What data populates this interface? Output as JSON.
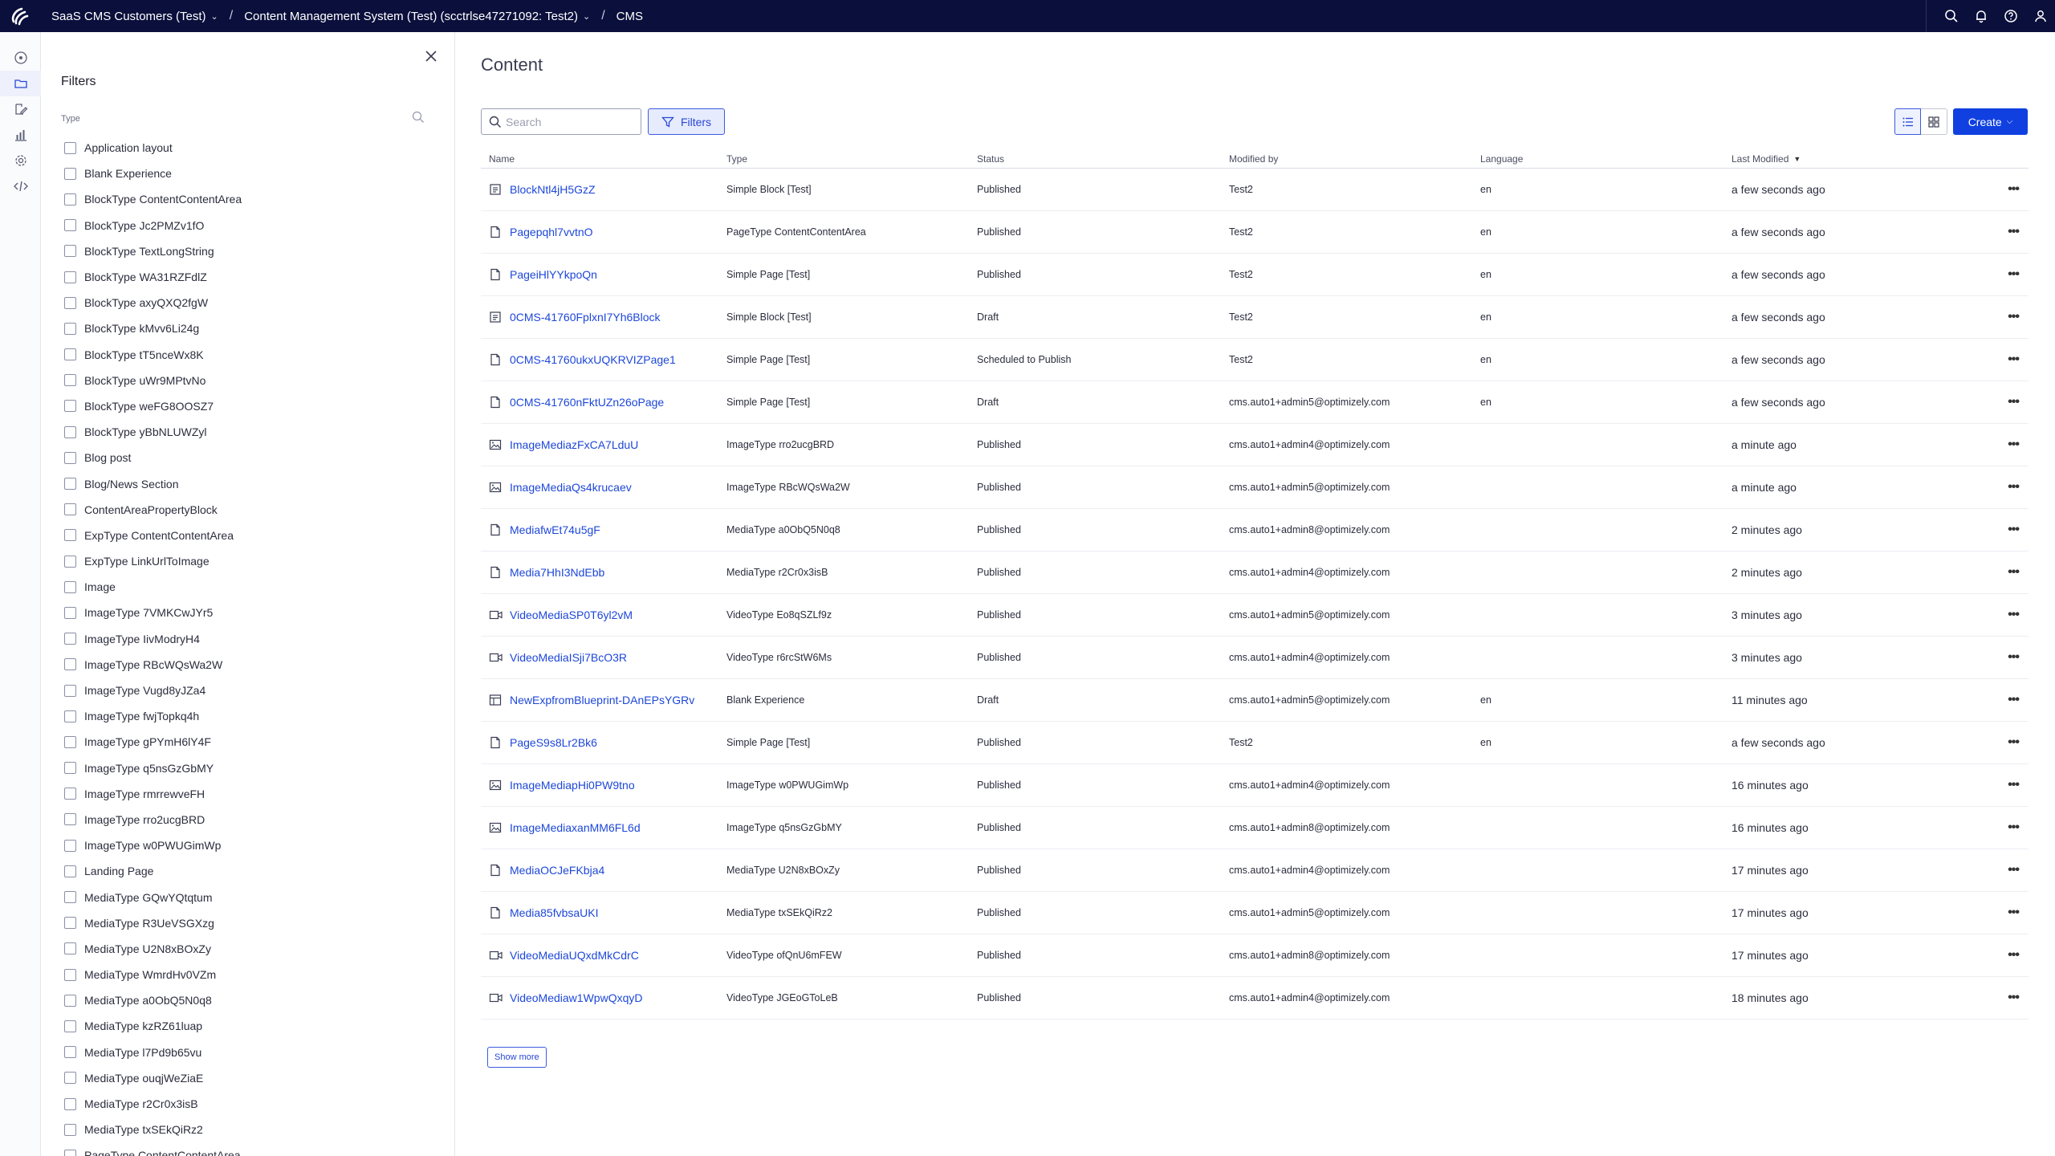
{
  "topbar": {
    "breadcrumbs": [
      {
        "label": "SaaS CMS Customers (Test)",
        "has_dropdown": true
      },
      {
        "label": "Content Management System (Test) (scctrlse47271092: Test2)",
        "has_dropdown": true
      },
      {
        "label": "CMS",
        "has_dropdown": false
      }
    ],
    "icons": [
      "search-icon",
      "bell-icon",
      "help-icon",
      "user-icon"
    ],
    "background": "#0b0f3c"
  },
  "rail": {
    "icons": [
      "dashboard-icon",
      "content-icon",
      "edit-icon",
      "analytics-icon",
      "settings-icon",
      "code-icon"
    ]
  },
  "filters": {
    "title": "Filters",
    "type_label": "Type",
    "types": [
      "Application layout",
      "Blank Experience",
      "BlockType ContentContentArea",
      "BlockType Jc2PMZv1fO",
      "BlockType TextLongString",
      "BlockType WA31RZFdlZ",
      "BlockType axyQXQ2fgW",
      "BlockType kMvv6Li24g",
      "BlockType tT5nceWx8K",
      "BlockType uWr9MPtvNo",
      "BlockType weFG8OOSZ7",
      "BlockType yBbNLUWZyl",
      "Blog post",
      "Blog/News Section",
      "ContentAreaPropertyBlock",
      "ExpType ContentContentArea",
      "ExpType LinkUrlToImage",
      "Image",
      "ImageType 7VMKCwJYr5",
      "ImageType IivModryH4",
      "ImageType RBcWQsWa2W",
      "ImageType Vugd8yJZa4",
      "ImageType fwjTopkq4h",
      "ImageType gPYmH6lY4F",
      "ImageType q5nsGzGbMY",
      "ImageType rmrrewveFH",
      "ImageType rro2ucgBRD",
      "ImageType w0PWUGimWp",
      "Landing Page",
      "MediaType GQwYQtqtum",
      "MediaType R3UeVSGXzg",
      "MediaType U2N8xBOxZy",
      "MediaType WmrdHv0VZm",
      "MediaType a0ObQ5N0q8",
      "MediaType kzRZ61luap",
      "MediaType l7Pd9b65vu",
      "MediaType ouqjWeZiaE",
      "MediaType r2Cr0x3isB",
      "MediaType txSEkQiRz2",
      "PageType ContentContentArea"
    ]
  },
  "main": {
    "title": "Content",
    "search_placeholder": "Search",
    "filters_button": "Filters",
    "create_button": "Create",
    "accent": "#1040e0",
    "columns": {
      "name": "Name",
      "type": "Type",
      "status": "Status",
      "modified_by": "Modified by",
      "language": "Language",
      "last_modified": "Last Modified"
    },
    "rows": [
      {
        "icon": "block-icon",
        "name": "BlockNtl4jH5GzZ",
        "type": "Simple Block [Test]",
        "status": "Published",
        "modified_by": "Test2",
        "language": "en",
        "last_modified": "a few seconds ago"
      },
      {
        "icon": "page-icon",
        "name": "Pagepqhl7vvtnO",
        "type": "PageType ContentContentArea",
        "status": "Published",
        "modified_by": "Test2",
        "language": "en",
        "last_modified": "a few seconds ago"
      },
      {
        "icon": "page-icon",
        "name": "PageiHlYYkpoQn",
        "type": "Simple Page [Test]",
        "status": "Published",
        "modified_by": "Test2",
        "language": "en",
        "last_modified": "a few seconds ago"
      },
      {
        "icon": "block-icon",
        "name": "0CMS-41760FplxnI7Yh6Block",
        "type": "Simple Block [Test]",
        "status": "Draft",
        "modified_by": "Test2",
        "language": "en",
        "last_modified": "a few seconds ago"
      },
      {
        "icon": "page-icon",
        "name": "0CMS-41760ukxUQKRVIZPage1",
        "type": "Simple Page [Test]",
        "status": "Scheduled to Publish",
        "modified_by": "Test2",
        "language": "en",
        "last_modified": "a few seconds ago"
      },
      {
        "icon": "page-icon",
        "name": "0CMS-41760nFktUZn26oPage",
        "type": "Simple Page [Test]",
        "status": "Draft",
        "modified_by": "cms.auto1+admin5@optimizely.com",
        "language": "en",
        "last_modified": "a few seconds ago"
      },
      {
        "icon": "image-icon",
        "name": "ImageMediazFxCA7LduU",
        "type": "ImageType rro2ucgBRD",
        "status": "Published",
        "modified_by": "cms.auto1+admin4@optimizely.com",
        "language": "",
        "last_modified": "a minute ago"
      },
      {
        "icon": "image-icon",
        "name": "ImageMediaQs4krucaev",
        "type": "ImageType RBcWQsWa2W",
        "status": "Published",
        "modified_by": "cms.auto1+admin5@optimizely.com",
        "language": "",
        "last_modified": "a minute ago"
      },
      {
        "icon": "page-icon",
        "name": "MediafwEt74u5gF",
        "type": "MediaType a0ObQ5N0q8",
        "status": "Published",
        "modified_by": "cms.auto1+admin8@optimizely.com",
        "language": "",
        "last_modified": "2 minutes ago"
      },
      {
        "icon": "page-icon",
        "name": "Media7HhI3NdEbb",
        "type": "MediaType r2Cr0x3isB",
        "status": "Published",
        "modified_by": "cms.auto1+admin4@optimizely.com",
        "language": "",
        "last_modified": "2 minutes ago"
      },
      {
        "icon": "video-icon",
        "name": "VideoMediaSP0T6yl2vM",
        "type": "VideoType Eo8qSZLf9z",
        "status": "Published",
        "modified_by": "cms.auto1+admin5@optimizely.com",
        "language": "",
        "last_modified": "3 minutes ago"
      },
      {
        "icon": "video-icon",
        "name": "VideoMediaISji7BcO3R",
        "type": "VideoType r6rcStW6Ms",
        "status": "Published",
        "modified_by": "cms.auto1+admin4@optimizely.com",
        "language": "",
        "last_modified": "3 minutes ago"
      },
      {
        "icon": "experience-icon",
        "name": "NewExpfromBlueprint-DAnEPsYGRv",
        "type": "Blank Experience",
        "status": "Draft",
        "modified_by": "cms.auto1+admin5@optimizely.com",
        "language": "en",
        "last_modified": "11 minutes ago"
      },
      {
        "icon": "page-icon",
        "name": "PageS9s8Lr2Bk6",
        "type": "Simple Page [Test]",
        "status": "Published",
        "modified_by": "Test2",
        "language": "en",
        "last_modified": "a few seconds ago"
      },
      {
        "icon": "image-icon",
        "name": "ImageMediapHi0PW9tno",
        "type": "ImageType w0PWUGimWp",
        "status": "Published",
        "modified_by": "cms.auto1+admin4@optimizely.com",
        "language": "",
        "last_modified": "16 minutes ago"
      },
      {
        "icon": "image-icon",
        "name": "ImageMediaxanMM6FL6d",
        "type": "ImageType q5nsGzGbMY",
        "status": "Published",
        "modified_by": "cms.auto1+admin8@optimizely.com",
        "language": "",
        "last_modified": "16 minutes ago"
      },
      {
        "icon": "page-icon",
        "name": "MediaOCJeFKbja4",
        "type": "MediaType U2N8xBOxZy",
        "status": "Published",
        "modified_by": "cms.auto1+admin4@optimizely.com",
        "language": "",
        "last_modified": "17 minutes ago"
      },
      {
        "icon": "page-icon",
        "name": "Media85fvbsaUKI",
        "type": "MediaType txSEkQiRz2",
        "status": "Published",
        "modified_by": "cms.auto1+admin5@optimizely.com",
        "language": "",
        "last_modified": "17 minutes ago"
      },
      {
        "icon": "video-icon",
        "name": "VideoMediaUQxdMkCdrC",
        "type": "VideoType ofQnU6mFEW",
        "status": "Published",
        "modified_by": "cms.auto1+admin8@optimizely.com",
        "language": "",
        "last_modified": "17 minutes ago"
      },
      {
        "icon": "video-icon",
        "name": "VideoMediaw1WpwQxqyD",
        "type": "VideoType JGEoGToLeB",
        "status": "Published",
        "modified_by": "cms.auto1+admin4@optimizely.com",
        "language": "",
        "last_modified": "18 minutes ago"
      }
    ],
    "show_more": "Show more"
  }
}
